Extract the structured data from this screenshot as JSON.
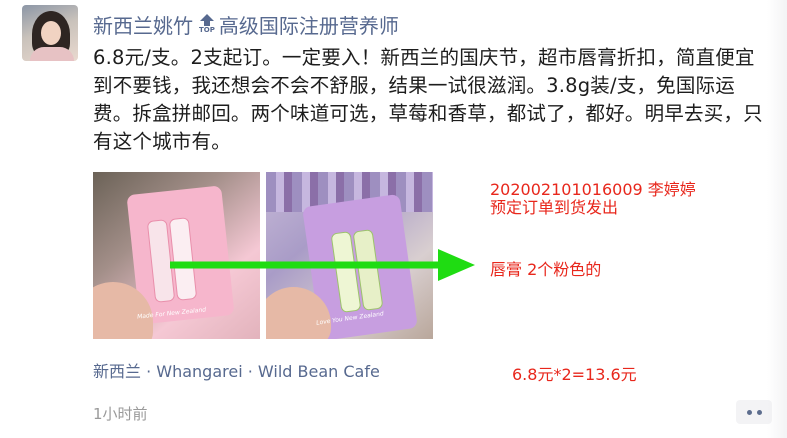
{
  "author": {
    "name": "新西兰姚竹",
    "top_badge": "TOP",
    "title": "高级国际注册营养师"
  },
  "post": {
    "text": "6.8元/支。2支起订。一定要入！新西兰的国庆节，超市唇膏折扣，简直便宜到不要钱，我还想会不会不舒服，结果一试很滋润。3.8g装/支，免国际运费。拆盒拼邮回。两个味道可选，草莓和香草，都试了，都好。明早去买，只有这个城市有。"
  },
  "photos": {
    "photo1_caption": "Made For New Zealand",
    "photo2_caption": "Love You New Zealand"
  },
  "location": {
    "text": "新西兰 · Whangarei · Wild Bean Cafe"
  },
  "time": "1小时前",
  "annotations": {
    "order_id": "20200210101600​9",
    "order_line": "202002101016009   李婷婷",
    "order_note": "预定订单到货发出",
    "item_note": "唇膏 2个粉色的",
    "price_calc": "6.8元*2=13.6元"
  },
  "colors": {
    "link_blue": "#57698f",
    "annotation_red": "#e8271c",
    "arrow_green": "#1fdc12"
  }
}
